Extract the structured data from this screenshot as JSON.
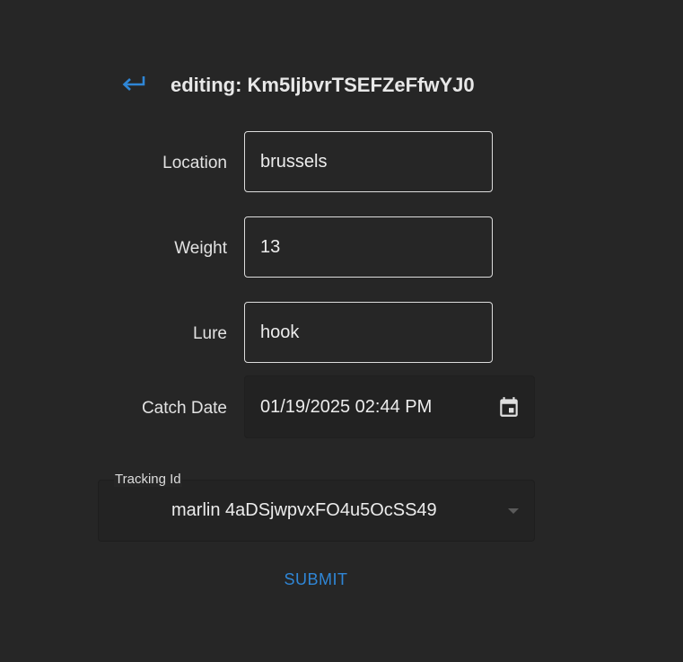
{
  "header": {
    "back_icon": "back-arrow-icon",
    "title": "editing: Km5IjbvrTSEFZeFfwYJ0"
  },
  "form": {
    "location": {
      "label": "Location",
      "value": "brussels"
    },
    "weight": {
      "label": "Weight",
      "value": "13"
    },
    "lure": {
      "label": "Lure",
      "value": "hook"
    },
    "catch_date": {
      "label": "Catch Date",
      "value": "01/19/2025 02:44 PM",
      "icon": "calendar-icon"
    },
    "tracking_id": {
      "label": "Tracking Id",
      "value": "marlin 4aDSjwpvxFO4u5OcSS49",
      "icon": "dropdown-arrow-icon"
    }
  },
  "actions": {
    "submit_label": "SUBMIT"
  },
  "colors": {
    "background": "#262626",
    "accent": "#2f86d6",
    "text": "#e6e6e6"
  }
}
